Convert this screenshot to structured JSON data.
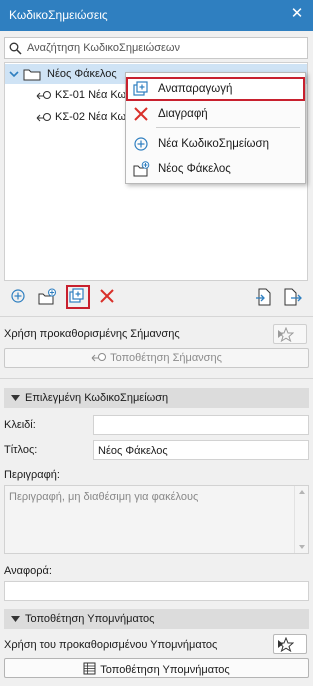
{
  "window": {
    "title": "ΚωδικοΣημειώσεις",
    "close_glyph": "✕"
  },
  "search": {
    "placeholder": "Αναζήτηση ΚωδικοΣημειώσεων"
  },
  "tree": {
    "root": {
      "label": "Νέος Φάκελος",
      "icon": "folder-icon"
    },
    "children": [
      {
        "label": "ΚΣ-01 Νέα Κω"
      },
      {
        "label": "ΚΣ-02 Νέα Κω"
      }
    ]
  },
  "context_menu": {
    "items": [
      {
        "label": "Αναπαραγωγή",
        "icon": "duplicate-icon",
        "highlighted": true
      },
      {
        "label": "Διαγραφή",
        "icon": "delete-icon"
      },
      {
        "label": "Νέα ΚωδικοΣημείωση",
        "icon": "add-circle-icon"
      },
      {
        "label": "Νέος Φάκελος",
        "icon": "new-folder-icon"
      }
    ]
  },
  "toolbar": {
    "buttons": [
      "add-circle-icon",
      "new-folder-icon",
      "duplicate-icon",
      "delete-icon",
      "import-icon",
      "export-icon"
    ],
    "highlighted": "duplicate-icon"
  },
  "usage": {
    "label": "Χρήση προκαθορισμένης Σήμανσης",
    "place_button": "Τοποθέτηση Σήμανσης"
  },
  "selected_section": {
    "title": "Επιλεγμένη ΚωδικοΣημείωση",
    "key_label": "Κλειδί:",
    "key_value": "",
    "title_label": "Τίτλος:",
    "title_value": "Νέος Φάκελος",
    "description_label": "Περιγραφή:",
    "description_placeholder": "Περιγραφή, μη διαθέσιμη για φακέλους",
    "reference_label": "Αναφορά:",
    "reference_value": ""
  },
  "legend_section": {
    "title": "Τοποθέτηση Υπομνήματος",
    "usage_label": "Χρήση του προκαθορισμένου Υπομνήματος",
    "place_button": "Τοποθέτηση Υπομνήματος"
  },
  "colors": {
    "titlebar": "#2f7fc0",
    "highlight_outline": "#c8202e",
    "accent_blue": "#2f7fc0",
    "delete_red": "#d9302a",
    "selection": "#cfe3f5"
  }
}
